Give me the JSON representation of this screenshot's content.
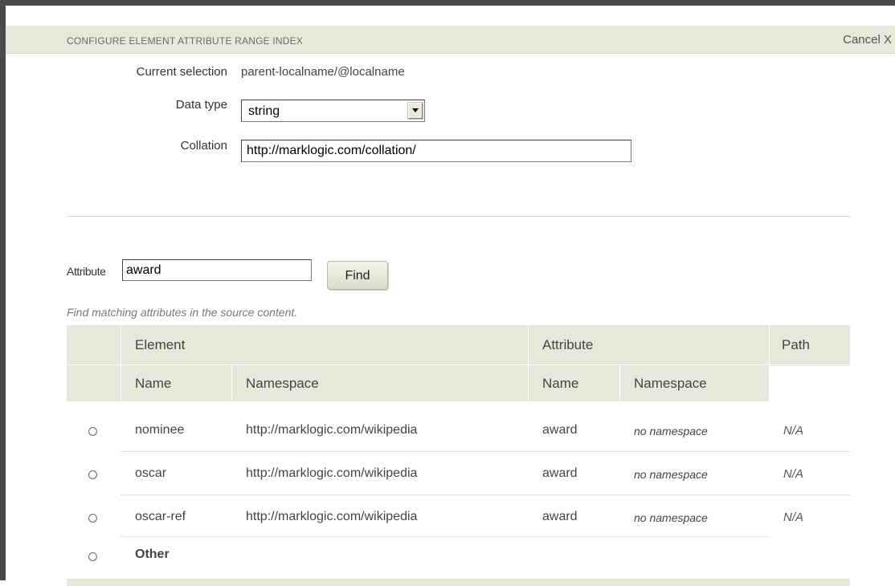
{
  "dialog": {
    "title": "CONFIGURE ELEMENT ATTRIBUTE RANGE INDEX",
    "cancel_label": "Cancel X"
  },
  "form": {
    "current_selection_label": "Current selection",
    "current_selection_value": "parent-localname/@localname",
    "data_type_label": "Data type",
    "data_type_value": "string",
    "collation_label": "Collation",
    "collation_value": "http://marklogic.com/collation/"
  },
  "search": {
    "attribute_label": "Attribute",
    "attribute_value": "award",
    "find_label": "Find",
    "hint": "Find matching attributes in the source content."
  },
  "table": {
    "group_headers": {
      "element": "Element",
      "attribute": "Attribute",
      "path": "Path"
    },
    "sub_headers": {
      "element_name": "Name",
      "element_namespace": "Namespace",
      "attribute_name": "Name",
      "attribute_namespace": "Namespace"
    },
    "rows": [
      {
        "element_name": "nominee",
        "element_namespace": "http://marklogic.com/wikipedia",
        "attribute_name": "award",
        "attribute_namespace": "no namespace",
        "path": "N/A"
      },
      {
        "element_name": "oscar",
        "element_namespace": "http://marklogic.com/wikipedia",
        "attribute_name": "award",
        "attribute_namespace": "no namespace",
        "path": "N/A"
      },
      {
        "element_name": "oscar-ref",
        "element_namespace": "http://marklogic.com/wikipedia",
        "attribute_name": "award",
        "attribute_namespace": "no namespace",
        "path": "N/A"
      }
    ],
    "other_label": "Other"
  },
  "colors": {
    "header_band": "#e7e8da",
    "window_border": "#4a4a4a"
  }
}
